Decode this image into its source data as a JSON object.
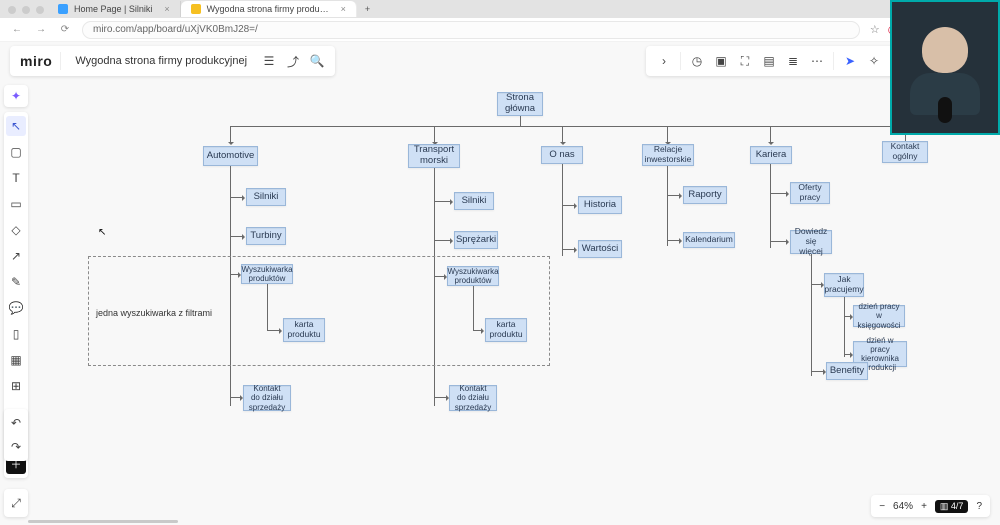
{
  "browser": {
    "tabs": [
      {
        "label": "Home Page | Silniki",
        "active": false
      },
      {
        "label": "Wygodna strona firmy produ…",
        "active": true
      }
    ],
    "url": "miro.com/app/board/uXjVK0BmJ28=/"
  },
  "header": {
    "logo": "miro",
    "board_name": "Wygodna strona firmy produkcyjnej"
  },
  "zoom": {
    "percent": "64%",
    "frames": "4/7",
    "btn_minus": "−",
    "btn_plus": "+"
  },
  "dash_label": "jedna wyszukiwarka z filtrami",
  "nodes": {
    "root": "Strona główna",
    "automotive": "Automotive",
    "auto_silniki": "Silniki",
    "auto_turbiny": "Turbiny",
    "auto_search": "Wyszukiwarka produktów",
    "auto_card": "karta produktu",
    "auto_contact": "Kontakt do działu sprzedaży",
    "transport": "Transport morski",
    "tr_silniki": "Silniki",
    "tr_spr": "Sprężarki",
    "tr_search": "Wyszukiwarka produktów",
    "tr_card": "karta produktu",
    "tr_contact": "Kontakt do działu sprzedaży",
    "onas": "O nas",
    "historia": "Historia",
    "wartosci": "Wartości",
    "relacje": "Relacje inwestorskie",
    "raporty": "Raporty",
    "kalendarium": "Kalendarium",
    "kariera": "Kariera",
    "oferty": "Oferty pracy",
    "dowiedz": "Dowiedz się więcej",
    "jak": "Jak pracujemy",
    "dzien_ks": "dzień pracy w księgowości",
    "dzien_kp": "dzień w pracy kierownika produkcji",
    "benefity": "Benefity",
    "kontakt": "Kontakt ogólny"
  }
}
